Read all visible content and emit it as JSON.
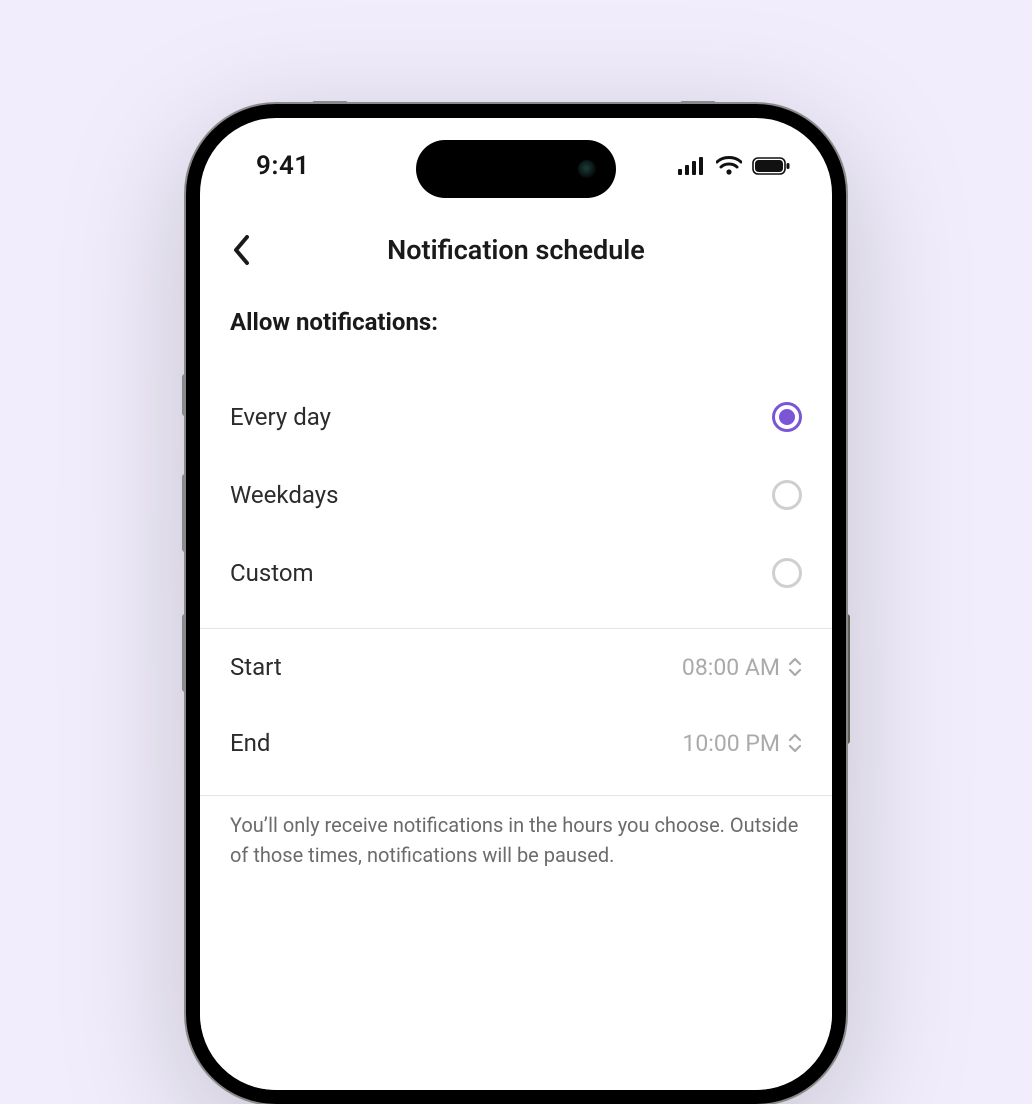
{
  "statusbar": {
    "time": "9:41"
  },
  "nav": {
    "title": "Notification schedule"
  },
  "section_label": "Allow notifications:",
  "radios": {
    "every_day": "Every day",
    "weekdays": "Weekdays",
    "custom": "Custom",
    "selected": "every_day"
  },
  "times": {
    "start_label": "Start",
    "start_value": "08:00 AM",
    "end_label": "End",
    "end_value": "10:00 PM"
  },
  "help": "You’ll only receive notifications in the hours you choose. Outside of those times, notifications will be paused.",
  "colors": {
    "accent": "#7b55d6"
  }
}
